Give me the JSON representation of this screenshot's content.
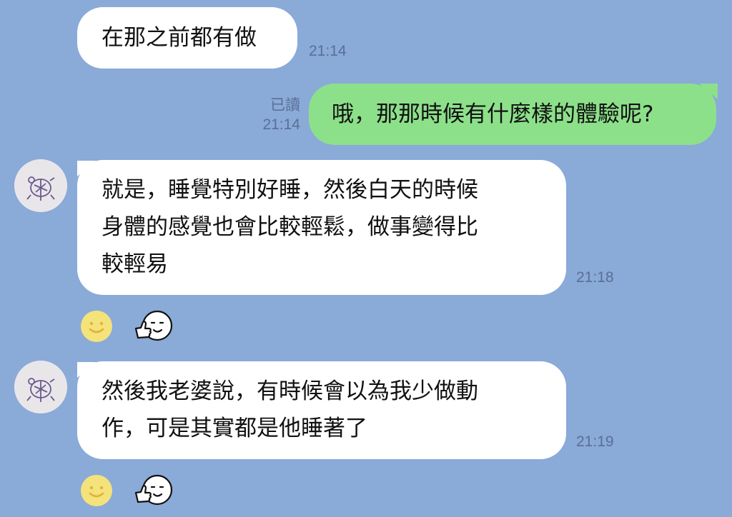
{
  "messages": [
    {
      "sender": "other",
      "lines": [
        "在那之前都有做"
      ],
      "time": "21:14"
    },
    {
      "sender": "me",
      "lines": [
        "哦，那那時候有什麼樣的體驗呢?"
      ],
      "time": "21:14",
      "read_label": "已讀"
    },
    {
      "sender": "other",
      "lines": [
        "就是，睡覺特別好睡，然後白天的時候",
        "身體的感覺也會比較輕鬆，做事變得比",
        "較輕易"
      ],
      "time": "21:18",
      "reactions": [
        "smile-reaction-icon",
        "thumbs-up-face-sticker-icon"
      ]
    },
    {
      "sender": "other",
      "lines": [
        "然後我老婆說，有時候會以為我少做動",
        "作，可是其實都是他睡著了"
      ],
      "time": "21:19",
      "reactions": [
        "smile-reaction-icon",
        "thumbs-up-face-sticker-icon"
      ]
    }
  ],
  "colors": {
    "background": "#8aaad8",
    "incoming": "#ffffff",
    "outgoing": "#8de08a",
    "meta": "#5a6f96"
  }
}
